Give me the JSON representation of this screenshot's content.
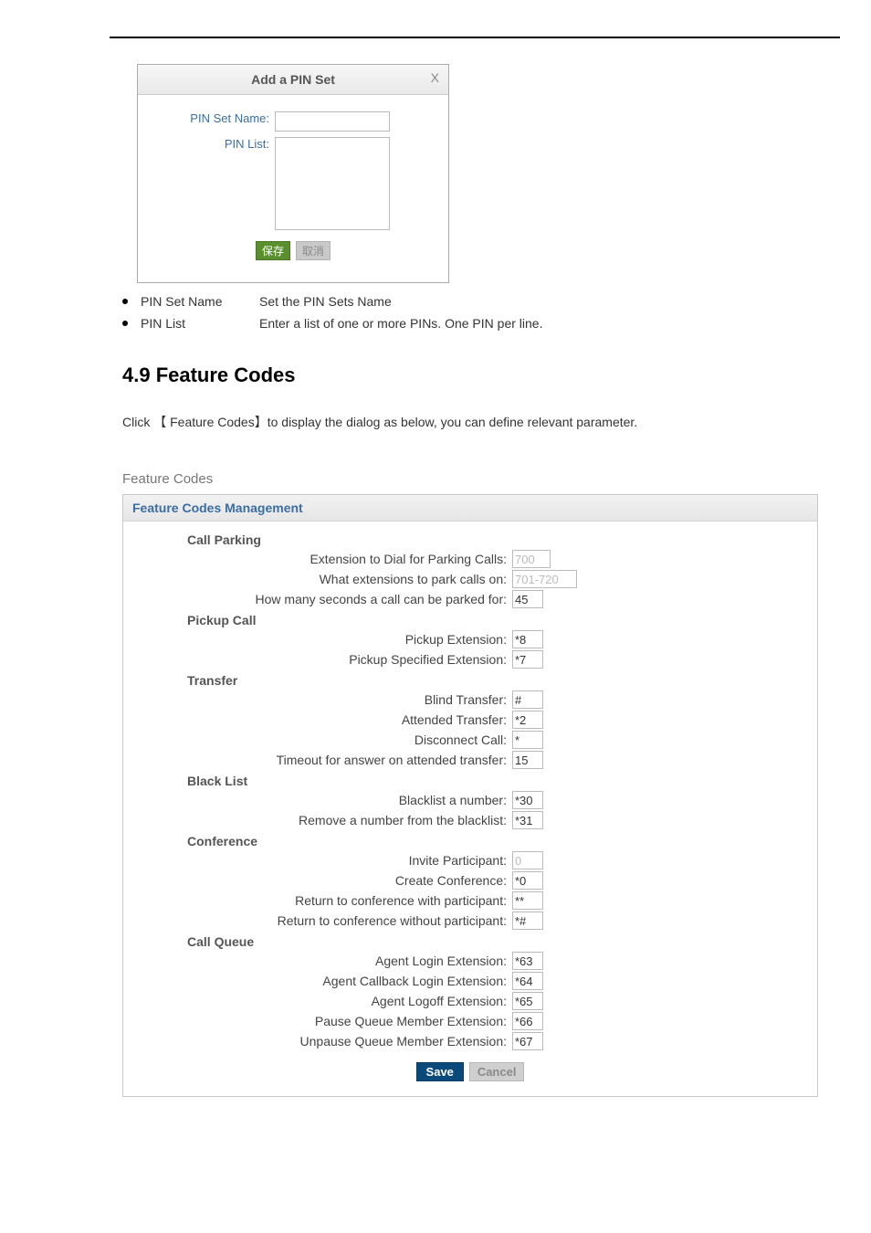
{
  "modal": {
    "title": "Add a PIN Set",
    "close": "X",
    "pin_set_name_label": "PIN Set Name:",
    "pin_list_label": "PIN List:",
    "pin_set_name_value": "",
    "pin_list_value": "",
    "save_btn": "保存",
    "cancel_btn": "取消"
  },
  "bullets": {
    "items": [
      {
        "term": "PIN Set Name",
        "desc": "Set the PIN Sets Name"
      },
      {
        "term": "PIN List",
        "desc": "Enter a list of one or more PINs. One PIN per line."
      }
    ]
  },
  "section": {
    "heading": "4.9 Feature Codes",
    "intro": "Click 【 Feature Codes】to display the dialog as below, you can define relevant parameter."
  },
  "fc": {
    "outer_title": "Feature Codes",
    "panel_title": "Feature Codes Management",
    "groups": {
      "call_parking": {
        "title": "Call Parking",
        "rows": [
          {
            "label": "Extension to Dial for Parking Calls:",
            "value": "700",
            "disabled": true
          },
          {
            "label": "What extensions to park calls on:",
            "value": "701-720",
            "disabled": true,
            "wide": true
          },
          {
            "label": "How many seconds a call can be parked for:",
            "value": "45"
          }
        ]
      },
      "pickup_call": {
        "title": "Pickup Call",
        "rows": [
          {
            "label": "Pickup Extension:",
            "value": "*8"
          },
          {
            "label": "Pickup Specified Extension:",
            "value": "*7"
          }
        ]
      },
      "transfer": {
        "title": "Transfer",
        "rows": [
          {
            "label": "Blind Transfer:",
            "value": "#"
          },
          {
            "label": "Attended Transfer:",
            "value": "*2"
          },
          {
            "label": "Disconnect Call:",
            "value": "*"
          },
          {
            "label": "Timeout for answer on attended transfer:",
            "value": "15"
          }
        ]
      },
      "blacklist": {
        "title": "Black List",
        "rows": [
          {
            "label": "Blacklist a number:",
            "value": "*30"
          },
          {
            "label": "Remove a number from the blacklist:",
            "value": "*31"
          }
        ]
      },
      "conference": {
        "title": "Conference",
        "rows": [
          {
            "label": "Invite Participant:",
            "value": "0",
            "disabled": true
          },
          {
            "label": "Create Conference:",
            "value": "*0"
          },
          {
            "label": "Return to conference with participant:",
            "value": "**"
          },
          {
            "label": "Return to conference without participant:",
            "value": "*#"
          }
        ]
      },
      "call_queue": {
        "title": "Call Queue",
        "rows": [
          {
            "label": "Agent Login Extension:",
            "value": "*63"
          },
          {
            "label": "Agent Callback Login Extension:",
            "value": "*64"
          },
          {
            "label": "Agent Logoff Extension:",
            "value": "*65"
          },
          {
            "label": "Pause Queue Member Extension:",
            "value": "*66"
          },
          {
            "label": "Unpause Queue Member Extension:",
            "value": "*67"
          }
        ]
      }
    },
    "save": "Save",
    "cancel": "Cancel"
  }
}
